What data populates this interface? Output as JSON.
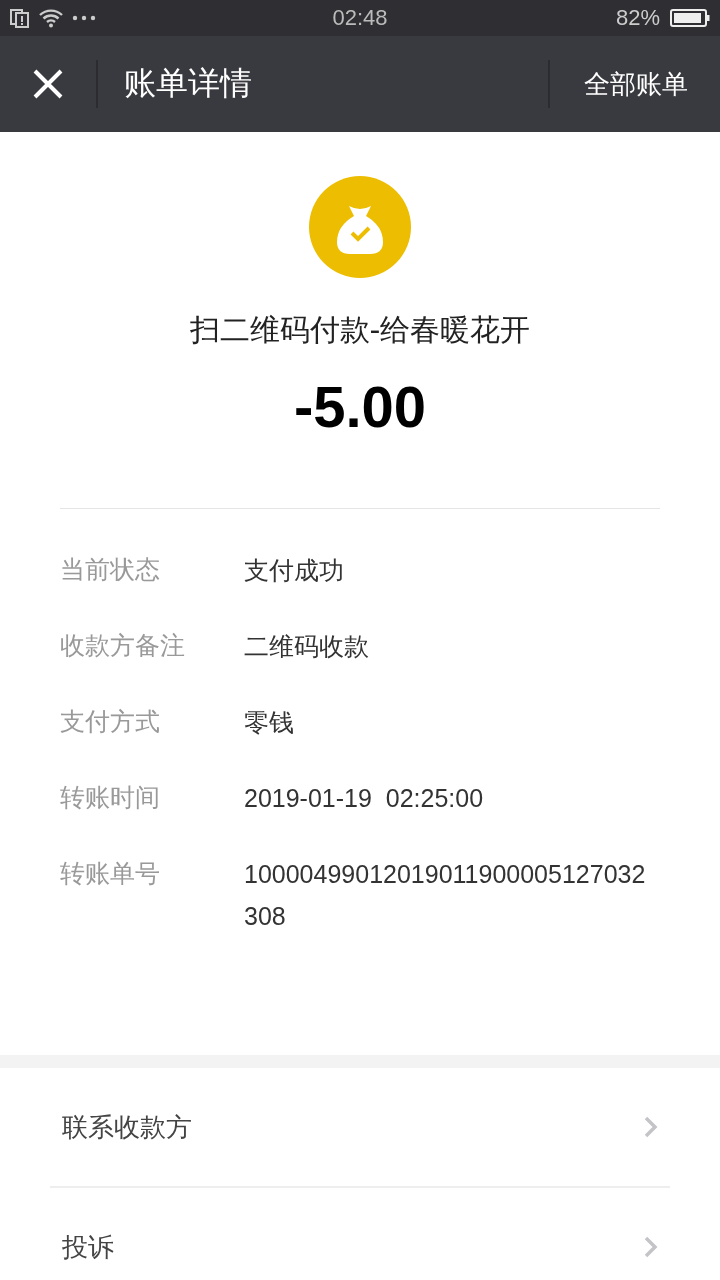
{
  "status_bar": {
    "time": "02:48",
    "battery": "82%"
  },
  "nav": {
    "title": "账单详情",
    "action": "全部账单"
  },
  "payment": {
    "title": "扫二维码付款-给春暖花开",
    "amount": "-5.00"
  },
  "details": [
    {
      "label": "当前状态",
      "value": "支付成功"
    },
    {
      "label": "收款方备注",
      "value": "二维码收款"
    },
    {
      "label": "支付方式",
      "value": "零钱"
    },
    {
      "label": "转账时间",
      "value": "2019-01-19  02:25:00"
    },
    {
      "label": "转账单号",
      "value": "10000499012019011900005127032308"
    }
  ],
  "links": [
    "联系收款方",
    "投诉"
  ]
}
